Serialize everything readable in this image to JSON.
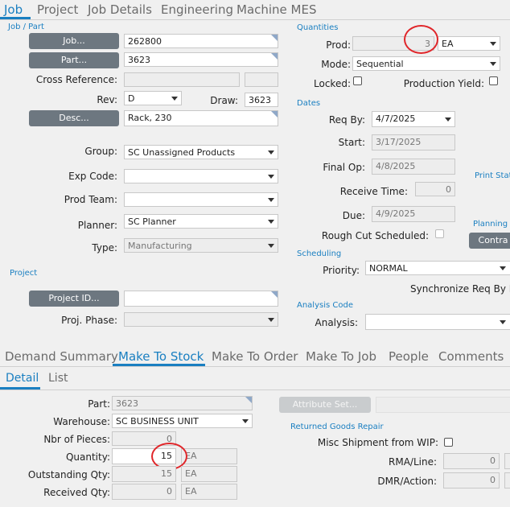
{
  "top_tabs": [
    "Job",
    "Project",
    "Job Details",
    "Engineering",
    "Machine MES"
  ],
  "sections": {
    "job_part": "Job / Part",
    "project": "Project",
    "quantities": "Quantities",
    "dates": "Dates",
    "scheduling": "Scheduling",
    "analysis_code": "Analysis Code",
    "print_status": "Print Statu",
    "planning": "Planning (",
    "returned_goods": "Returned Goods Repair"
  },
  "job_part": {
    "job_button": "Job...",
    "job_value": "262800",
    "part_button": "Part...",
    "part_value": "3623",
    "cross_ref_label": "Cross Reference:",
    "rev_label": "Rev:",
    "rev_value": "D",
    "draw_label": "Draw:",
    "draw_value": "3623",
    "desc_button": "Desc...",
    "desc_value": "Rack, 230",
    "group_label": "Group:",
    "group_value": "SC Unassigned Products",
    "exp_code_label": "Exp Code:",
    "prod_team_label": "Prod Team:",
    "planner_label": "Planner:",
    "planner_value": "SC Planner",
    "type_label": "Type:",
    "type_value": "Manufacturing"
  },
  "project": {
    "project_id_button": "Project ID...",
    "proj_phase_label": "Proj. Phase:"
  },
  "quantities": {
    "prod_label": "Prod:",
    "prod_value": "3",
    "prod_uom": "EA",
    "mode_label": "Mode:",
    "mode_value": "Sequential",
    "locked_label": "Locked:",
    "prod_yield_label": "Production Yield:"
  },
  "dates": {
    "req_by_label": "Req By:",
    "req_by_value": "4/7/2025",
    "start_label": "Start:",
    "start_value": "3/17/2025",
    "final_op_label": "Final Op:",
    "final_op_value": "4/8/2025",
    "receive_time_label": "Receive Time:",
    "receive_time_value": "0",
    "due_label": "Due:",
    "due_value": "4/9/2025",
    "rough_cut_label": "Rough Cut Scheduled:",
    "contra_button": "Contra"
  },
  "scheduling": {
    "priority_label": "Priority:",
    "priority_value": "NORMAL",
    "sync_label": "Synchronize Req By Da"
  },
  "analysis": {
    "analysis_label": "Analysis:"
  },
  "bottom_tabs": [
    "Demand Summary",
    "Make To Stock",
    "Make To Order",
    "Make To Job",
    "People",
    "Comments"
  ],
  "sub_tabs": [
    "Detail",
    "List"
  ],
  "detail": {
    "part_label": "Part:",
    "part_value": "3623",
    "warehouse_label": "Warehouse:",
    "warehouse_value": "SC BUSINESS UNIT",
    "pieces_label": "Nbr of Pieces:",
    "pieces_value": "0",
    "quantity_label": "Quantity:",
    "quantity_value": "15",
    "quantity_uom": "EA",
    "outstanding_label": "Outstanding Qty:",
    "outstanding_value": "15",
    "outstanding_uom": "EA",
    "received_label": "Received Qty:",
    "received_value": "0",
    "received_uom": "EA",
    "attribute_button": "Attribute Set...",
    "misc_shipment_label": "Misc Shipment from WIP:",
    "rma_label": "RMA/Line:",
    "rma_value": "0",
    "dmr_label": "DMR/Action:",
    "dmr_value": "0"
  },
  "colors": {
    "accent": "#1a7fc1",
    "button": "#6d7780",
    "annotation": "#e0262a"
  }
}
